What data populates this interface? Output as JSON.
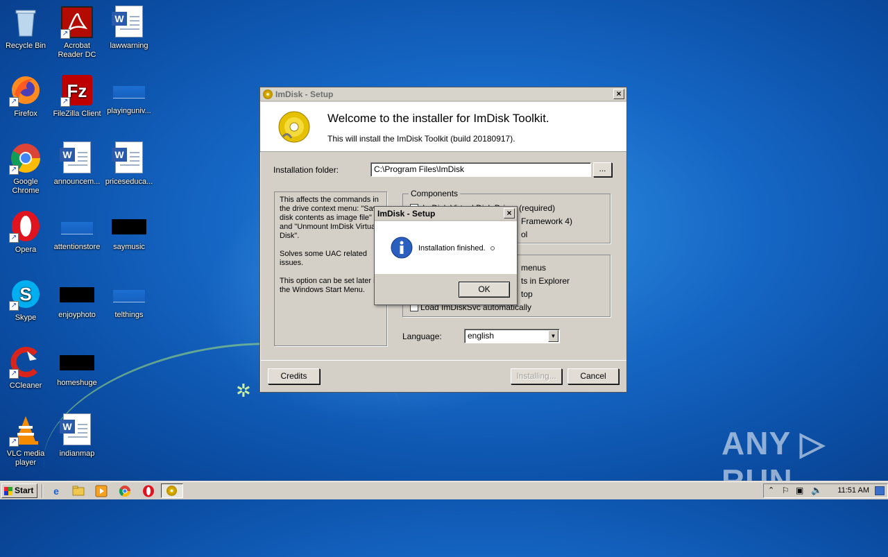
{
  "desktop_icons": [
    {
      "label": "Recycle Bin"
    },
    {
      "label": "Acrobat Reader DC"
    },
    {
      "label": "lawwarning"
    },
    {
      "label": "Firefox"
    },
    {
      "label": "FileZilla Client"
    },
    {
      "label": "playinguniv..."
    },
    {
      "label": "Google Chrome"
    },
    {
      "label": "announcem..."
    },
    {
      "label": "priceseduca..."
    },
    {
      "label": "Opera"
    },
    {
      "label": "attentionstore"
    },
    {
      "label": "saymusic"
    },
    {
      "label": "Skype"
    },
    {
      "label": "enjoyphoto"
    },
    {
      "label": "telthings"
    },
    {
      "label": "CCleaner"
    },
    {
      "label": "homeshuge"
    },
    {
      "label": "VLC media player"
    },
    {
      "label": "indianmap"
    }
  ],
  "setup": {
    "title": "ImDisk - Setup",
    "heading": "Welcome to the installer for ImDisk Toolkit.",
    "subheading": "This will install the ImDisk Toolkit (build 20180917).",
    "folder_label": "Installation folder:",
    "folder_value": "C:\\Program Files\\ImDisk",
    "browse_label": "...",
    "info_text_1": "This affects the commands in the drive context menu: \"Save disk contents as image file\" and \"Unmount ImDisk Virtual Disk\".",
    "info_text_2": "Solves some UAC related issues.",
    "info_text_3": "This option can be set later in the Windows Start Menu.",
    "components_label": "Components",
    "comp_1": "ImDisk Virtual Disk Driver (required)",
    "comp_2": "Framework 4)",
    "comp_3": "ol",
    "opt_1": "menus",
    "opt_2": "ts in Explorer",
    "opt_3": "top",
    "opt_4": "Load ImDiskSvc automatically",
    "language_label": "Language:",
    "language_value": "english",
    "credits_label": "Credits",
    "installing_label": "Installing...",
    "cancel_label": "Cancel"
  },
  "msgbox": {
    "title": "ImDisk - Setup",
    "message": "Installation finished.",
    "ok_label": "OK"
  },
  "taskbar": {
    "start_label": "Start",
    "clock": "11:51 AM"
  },
  "watermark": "ANY ▷ RUN"
}
